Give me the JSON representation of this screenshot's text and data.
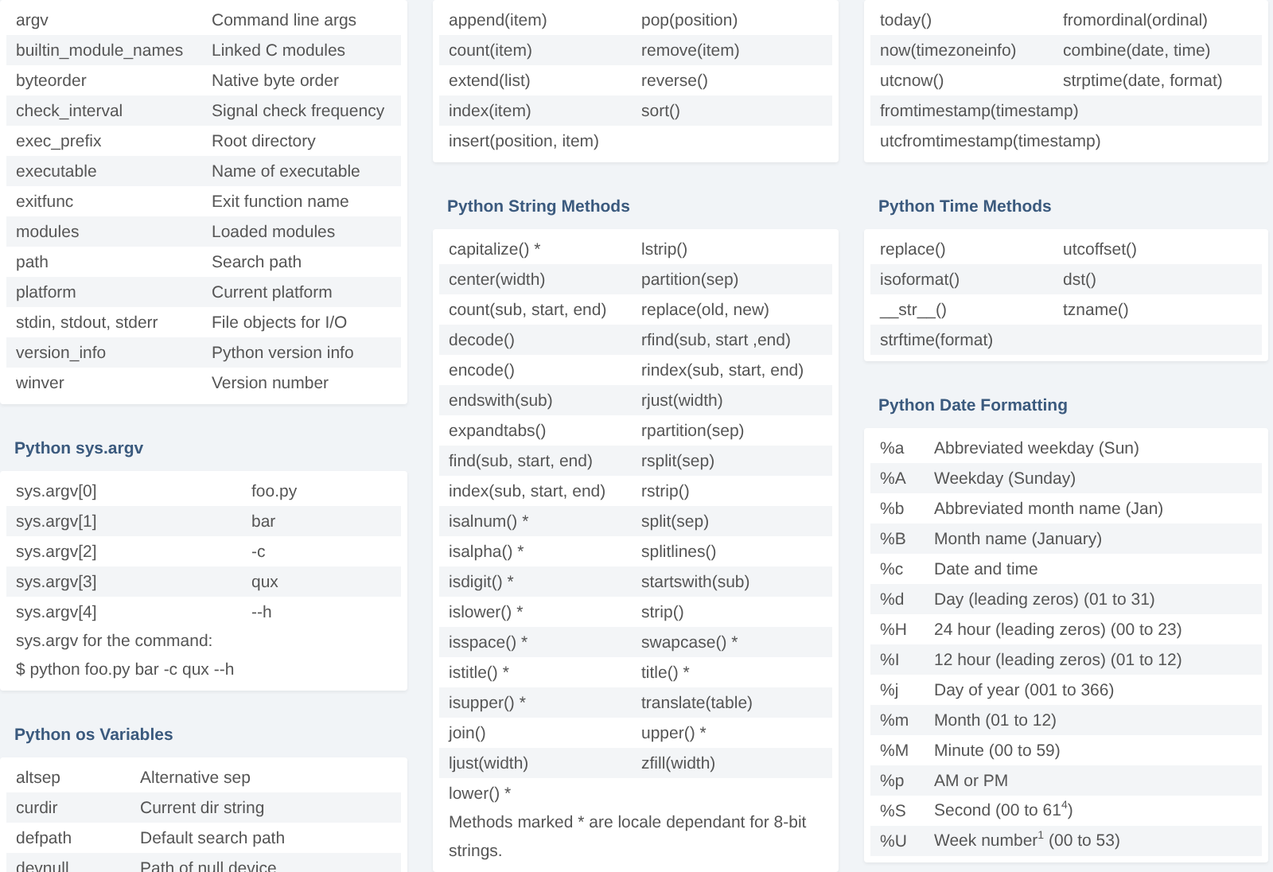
{
  "columns": [
    {
      "sections": [
        {
          "rows": [
            [
              "argv",
              "Command line args"
            ],
            [
              "builtin_module_names",
              "Linked C modules"
            ],
            [
              "byteorder",
              "Native byte order"
            ],
            [
              "check_interval",
              "Signal check frequency"
            ],
            [
              "exec_prefix",
              "Root directory"
            ],
            [
              "executable",
              "Name of executable"
            ],
            [
              "exitfunc",
              "Exit function name"
            ],
            [
              "modules",
              "Loaded modules"
            ],
            [
              "path",
              "Search path"
            ],
            [
              "platform",
              "Current platform"
            ],
            [
              "stdin, stdout, stderr",
              "File objects for I/O"
            ],
            [
              "version_info",
              "Python version info"
            ],
            [
              "winver",
              "Version number"
            ]
          ]
        },
        {
          "title": "Python sys.argv",
          "rows": [
            [
              "sys.argv[0]",
              "foo.py"
            ],
            [
              "sys.argv[1]",
              "bar"
            ],
            [
              "sys.argv[2]",
              "-c"
            ],
            [
              "sys.argv[3]",
              "qux"
            ],
            [
              "sys.argv[4]",
              "--h"
            ]
          ],
          "notes": [
            "sys.argv for the command:",
            "$ python foo.py bar -c qux --h"
          ]
        },
        {
          "title": "Python os Variables",
          "rows": [
            [
              "altsep",
              "Alternative sep"
            ],
            [
              "curdir",
              "Current dir string"
            ],
            [
              "defpath",
              "Default search path"
            ],
            [
              "devnull",
              "Path of null device"
            ]
          ]
        }
      ]
    },
    {
      "sections": [
        {
          "rows": [
            [
              "append(item)",
              "pop(position)"
            ],
            [
              "count(item)",
              "remove(item)"
            ],
            [
              "extend(list)",
              "reverse()"
            ],
            [
              "index(item)",
              "sort()"
            ],
            [
              "insert(position, item)"
            ]
          ]
        },
        {
          "title": "Python String Methods",
          "rows": [
            [
              "capitalize() *",
              "lstrip()"
            ],
            [
              "center(width)",
              "partition(sep)"
            ],
            [
              "count(sub, start, end)",
              "replace(old, new)"
            ],
            [
              "decode()",
              "rfind(sub, start ,end)"
            ],
            [
              "encode()",
              "rindex(sub, start, end)"
            ],
            [
              "endswith(sub)",
              "rjust(width)"
            ],
            [
              "expandtabs()",
              "rpartition(sep)"
            ],
            [
              "find(sub, start, end)",
              "rsplit(sep)"
            ],
            [
              "index(sub, start, end)",
              "rstrip()"
            ],
            [
              "isalnum() *",
              "split(sep)"
            ],
            [
              "isalpha() *",
              "splitlines()"
            ],
            [
              "isdigit() *",
              "startswith(sub)"
            ],
            [
              "islower() *",
              "strip()"
            ],
            [
              "isspace() *",
              "swapcase() *"
            ],
            [
              "istitle() *",
              "title() *"
            ],
            [
              "isupper() *",
              "translate(table)"
            ],
            [
              "join()",
              "upper() *"
            ],
            [
              "ljust(width)",
              "zfill(width)"
            ],
            [
              "lower() *"
            ]
          ],
          "notes": [
            "Methods marked * are locale dependant for 8-bit strings."
          ]
        }
      ]
    },
    {
      "sections": [
        {
          "rows": [
            [
              "today()",
              "fromordinal(ordinal)"
            ],
            [
              "now(timezoneinfo)",
              "combine(date, time)"
            ],
            [
              "utcnow()",
              "strptime(date, format)"
            ],
            [
              "fromtimestamp(timestamp)"
            ],
            [
              "utcfromtimestamp(timestamp)"
            ]
          ]
        },
        {
          "title": "Python Time Methods",
          "rows": [
            [
              "replace()",
              "utcoffset()"
            ],
            [
              "isoformat()",
              "dst()"
            ],
            [
              "__str__()",
              "tzname()"
            ],
            [
              "strftime(format)"
            ]
          ]
        },
        {
          "title": "Python Date Formatting",
          "rows": [
            [
              "%a",
              "Abbreviated weekday (Sun)"
            ],
            [
              "%A",
              "Weekday (Sunday)"
            ],
            [
              "%b",
              "Abbreviated month name (Jan)"
            ],
            [
              "%B",
              "Month name (January)"
            ],
            [
              "%c",
              "Date and time"
            ],
            [
              "%d",
              "Day (leading zeros) (01 to 31)"
            ],
            [
              "%H",
              "24 hour (leading zeros) (00 to 23)"
            ],
            [
              "%I",
              "12 hour (leading zeros) (01 to 12)"
            ],
            [
              "%j",
              "Day of year (001 to 366)"
            ],
            [
              "%m",
              "Month (01 to 12)"
            ],
            [
              "%M",
              "Minute (00 to 59)"
            ],
            [
              "%p",
              "AM or PM"
            ],
            [
              "%S",
              "Second (00 to 61$^{4}$)"
            ],
            [
              "%U",
              "Week number$^{1}$ (00 to 53)"
            ]
          ]
        }
      ]
    }
  ]
}
